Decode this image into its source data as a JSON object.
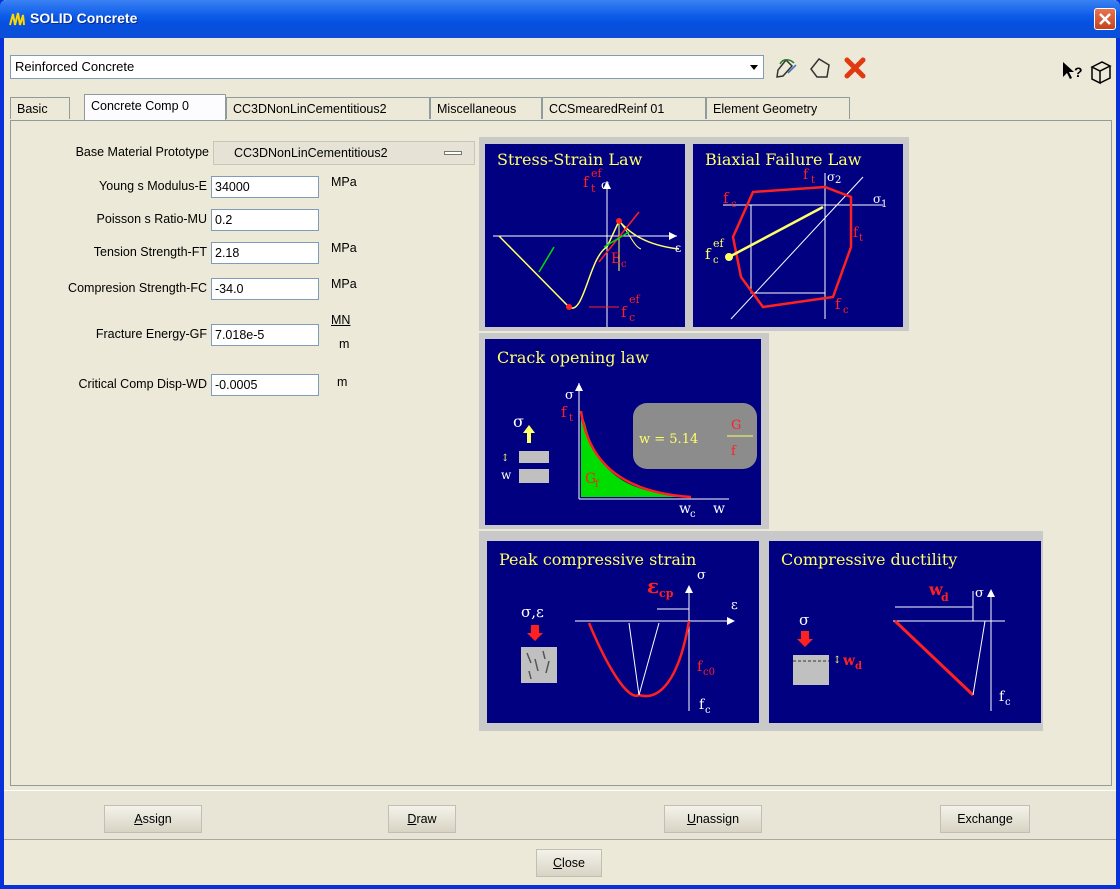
{
  "window": {
    "title": "SOLID Concrete"
  },
  "toolbar": {
    "combo_value": "Reinforced Concrete"
  },
  "tabs": [
    {
      "label": "Basic"
    },
    {
      "label": "Concrete Comp 0"
    },
    {
      "label": "CC3DNonLinCementitious2"
    },
    {
      "label": "Miscellaneous"
    },
    {
      "label": "CCSmearedReinf 01"
    },
    {
      "label": "Element Geometry"
    }
  ],
  "form": {
    "base_material": {
      "label": "Base Material Prototype",
      "value": "CC3DNonLinCementitious2"
    },
    "fields": [
      {
        "label": "Young s Modulus-E",
        "value": "34000",
        "unit": "MPa"
      },
      {
        "label": "Poisson s Ratio-MU",
        "value": "0.2",
        "unit": ""
      },
      {
        "label": "Tension Strength-FT",
        "value": "2.18",
        "unit": "MPa"
      },
      {
        "label": "Compresion Strength-FC",
        "value": "-34.0",
        "unit": "MPa"
      },
      {
        "label": "Fracture Energy-GF",
        "value": "7.018e-5",
        "unit_num": "MN",
        "unit_den": "m"
      },
      {
        "label": "Critical Comp Disp-WD",
        "value": "-0.0005",
        "unit": "m"
      }
    ]
  },
  "diagrams": {
    "stress_strain": {
      "title": "Stress-Strain Law"
    },
    "biaxial": {
      "title": "Biaxial Failure Law"
    },
    "crack": {
      "title": "Crack opening law"
    },
    "peak": {
      "title": "Peak compressive strain"
    },
    "ductility": {
      "title": "Compressive ductility"
    }
  },
  "buttons": {
    "assign": {
      "pre": "",
      "ul": "A",
      "post": "ssign"
    },
    "draw": {
      "pre": "",
      "ul": "D",
      "post": "raw"
    },
    "unassign": {
      "pre": "",
      "ul": "U",
      "post": "nassign"
    },
    "exchange": {
      "label": "Exchange"
    },
    "close": {
      "pre": "",
      "ul": "C",
      "post": "lose"
    }
  },
  "colors": {
    "title_bar": "#0a5ae8",
    "diagram_bg": "#000080",
    "diagram_title": "#ffff66",
    "red": "#ff2020",
    "green": "#00dd00"
  }
}
